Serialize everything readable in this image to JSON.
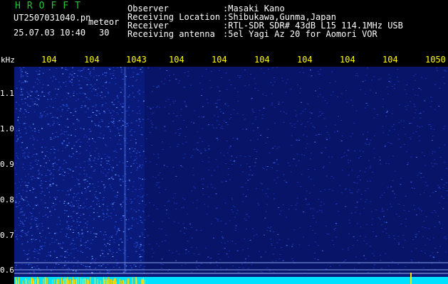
{
  "header": {
    "station_logo": "HROFFT",
    "filename": "UT2507031040.pn",
    "mode": "meteor",
    "timestamp": "25.07.03 10:40",
    "interval": "30",
    "fields": [
      {
        "label": "Observer",
        "value": ":Masaki Kano"
      },
      {
        "label": "Receiving Location",
        "value": ":Shibukawa,Gunma,Japan"
      },
      {
        "label": "Receiver",
        "value": ":RTL-SDR SDR# 43dB L15 114.1MHz USB"
      },
      {
        "label": "Receiving antenna",
        "value": ":5el Yagi Az 20 for Aomori VOR"
      }
    ]
  },
  "colors": {
    "background": "#000000",
    "plot_base": "#0a1a7a",
    "noise": "#2850d8",
    "baseline": "#00e0ff",
    "tick_label": "#ffff00",
    "logo": "#27c43a",
    "text": "#ffffff"
  },
  "chart_data": {
    "type": "heatmap",
    "xlabel": "",
    "ylabel": "kHz",
    "x_ticks": [
      "104",
      "104",
      "1043",
      "104",
      "104",
      "104",
      "104",
      "104",
      "104",
      "1050"
    ],
    "y_ticks": [
      "1.1",
      "1.0",
      "0.9",
      "0.8",
      "0.7",
      "0.6"
    ],
    "x_range": [
      1040,
      1050
    ],
    "y_range": [
      0.58,
      1.13
    ],
    "grid": false
  }
}
